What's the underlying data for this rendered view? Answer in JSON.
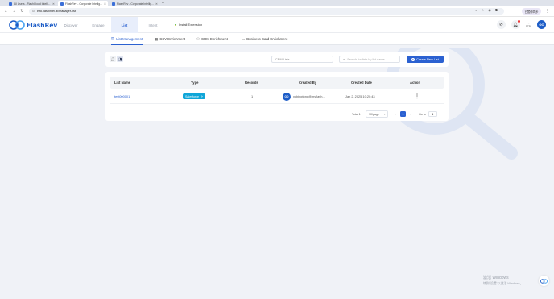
{
  "browser": {
    "tabs": [
      {
        "label": "All Users - FlashCloud Intelli...",
        "active": false
      },
      {
        "label": "FlashRev - Corporate Intellig...",
        "active": true
      },
      {
        "label": "FlashRev - Corporate Intellig...",
        "active": false
      }
    ],
    "url": "lnfo.flashintel.ai/manager-list",
    "profile_label": "已暂停同步"
  },
  "app": {
    "brand": "FlashRev",
    "nav": [
      {
        "label": "Discover",
        "active": false
      },
      {
        "label": "Engage",
        "active": false
      },
      {
        "label": "List",
        "active": true
      },
      {
        "label": "Intent",
        "active": false
      }
    ],
    "install_extension": "Install Extension",
    "credits_label": "1738",
    "avatar_initials": "OO"
  },
  "subnav": [
    {
      "label": "List Management",
      "icon": "list-icon",
      "active": true
    },
    {
      "label": "CSV Enrichment",
      "icon": "csv-icon",
      "active": false
    },
    {
      "label": "CRM Enrichment",
      "icon": "crm-icon",
      "active": false
    },
    {
      "label": "Business Card Enrichment",
      "icon": "card-icon",
      "active": false
    }
  ],
  "toolbar": {
    "crm_select_value": "CRM Lists",
    "search_placeholder": "Search for lists by list name",
    "create_label": "Create New List"
  },
  "table": {
    "columns": [
      "List Name",
      "Type",
      "Records",
      "Created By",
      "Created Date",
      "Action"
    ],
    "rows": [
      {
        "list_name": "test000001",
        "type": "Salesforce",
        "records": "1",
        "created_by": "yubingtong@myflash...",
        "created_date": "Jan 2, 2025 10:20:43"
      }
    ]
  },
  "pagination": {
    "total": "Total 1",
    "page_size": "10/page",
    "current_page": "1",
    "goto_label": "Go to",
    "goto_value": "1"
  },
  "windows": {
    "activate_title": "激活 Windows",
    "activate_sub": "转到\"设置\"以激活 Windows。"
  },
  "colors": {
    "primary": "#2b61d1",
    "salesforce_badge": "#10a6d8",
    "background": "#f0f2f7"
  }
}
